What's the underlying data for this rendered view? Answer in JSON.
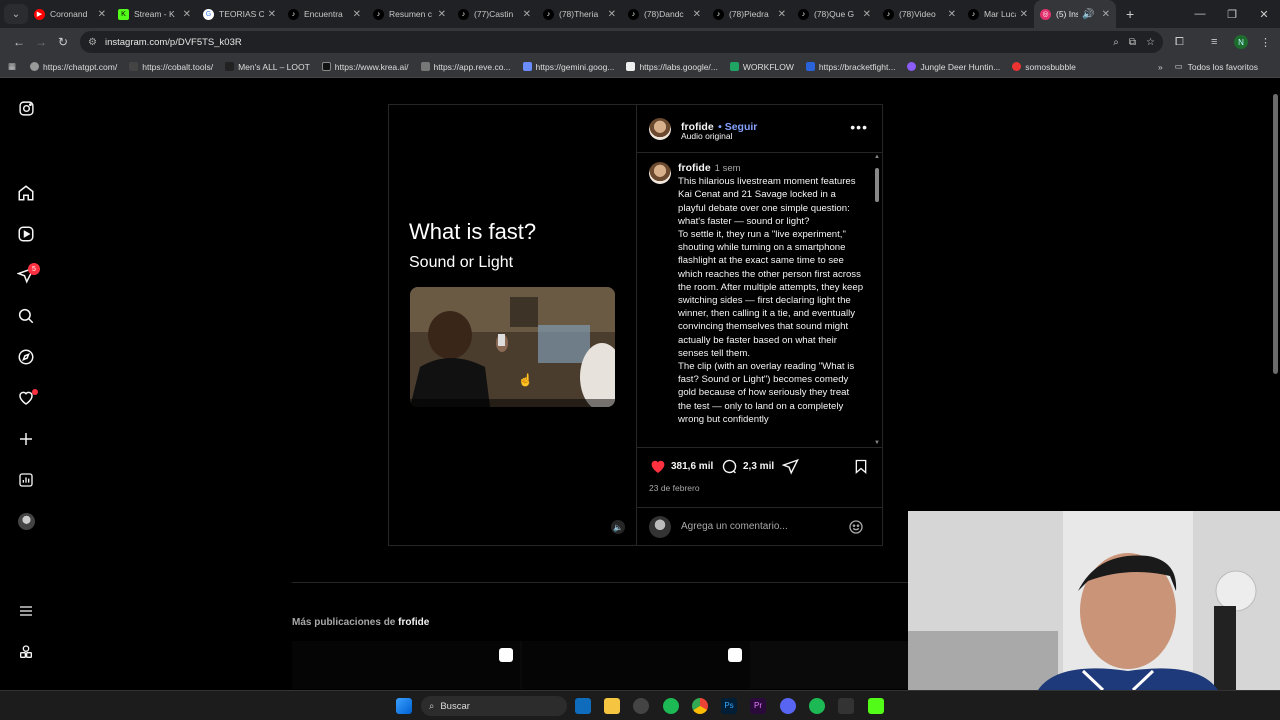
{
  "browser": {
    "tabs": [
      {
        "label": "Coronand",
        "icon": "youtube-icon",
        "color": "#ff0000"
      },
      {
        "label": "Stream - K",
        "icon": "kick-icon",
        "color": "#53fc18"
      },
      {
        "label": "TEORIAS C",
        "icon": "google-icon",
        "color": "#4285f4"
      },
      {
        "label": "Encuentra",
        "icon": "tiktok-icon",
        "color": "#ffffff"
      },
      {
        "label": "Resumen c",
        "icon": "tiktok-icon",
        "color": "#ffffff"
      },
      {
        "label": "(77)Castin",
        "icon": "tiktok-icon",
        "color": "#ffffff"
      },
      {
        "label": "(78)Theria",
        "icon": "tiktok-icon",
        "color": "#ffffff"
      },
      {
        "label": "(78)Dandc",
        "icon": "tiktok-icon",
        "color": "#ffffff"
      },
      {
        "label": "(78)Piedra",
        "icon": "tiktok-icon",
        "color": "#ffffff"
      },
      {
        "label": "(78)Que G",
        "icon": "tiktok-icon",
        "color": "#ffffff"
      },
      {
        "label": "(78)Video",
        "icon": "tiktok-icon",
        "color": "#ffffff"
      },
      {
        "label": "Mar Lucas",
        "icon": "tiktok-icon",
        "color": "#ffffff"
      },
      {
        "label": "(5) Ins",
        "icon": "instagram-icon",
        "color": "#e1306c"
      }
    ],
    "url": "instagram.com/p/DVF5TS_k03R",
    "bookmarks": [
      "https://chatgpt.com/",
      "https://cobalt.tools/",
      "Men's ALL – LOOT",
      "https://www.krea.ai/",
      "https://app.reve.co...",
      "https://gemini.goog...",
      "https://labs.google/...",
      "WORKFLOW",
      "https://bracketfight...",
      "Jungle Deer Huntin...",
      "somosbubble"
    ],
    "all_bookmarks": "Todos los favoritos",
    "profile_initial": "N"
  },
  "nav": {
    "notification_count": "5"
  },
  "post": {
    "video_title": "What is fast?",
    "video_subtitle": "Sound or Light",
    "username": "frofide",
    "follow": "Seguir",
    "audio": "Audio original",
    "time_ago": "1 sem",
    "caption_1": "This hilarious livestream moment features Kai Cenat and 21 Savage locked in a playful debate over one simple question: what's faster — sound or light?",
    "caption_2": "To settle it, they run a \"live experiment,\" shouting while turning on a smartphone flashlight at the exact same time to see which reaches the other person first across the room. After multiple attempts, they keep switching sides — first declaring light the winner, then calling it a tie, and eventually convincing themselves that sound might actually be faster based on what their senses tell them.",
    "caption_3": "The clip (with an overlay reading \"What is fast? Sound or Light\") becomes comedy gold because of how seriously they treat the test — only to land on a completely wrong but confidently",
    "likes": "381,6 mil",
    "comments": "2,3 mil",
    "date": "23 de febrero",
    "comment_placeholder": "Agrega un comentario..."
  },
  "more_posts": {
    "prefix": "Más publicaciones de",
    "user": "frofide"
  },
  "taskbar": {
    "search": "Buscar"
  }
}
